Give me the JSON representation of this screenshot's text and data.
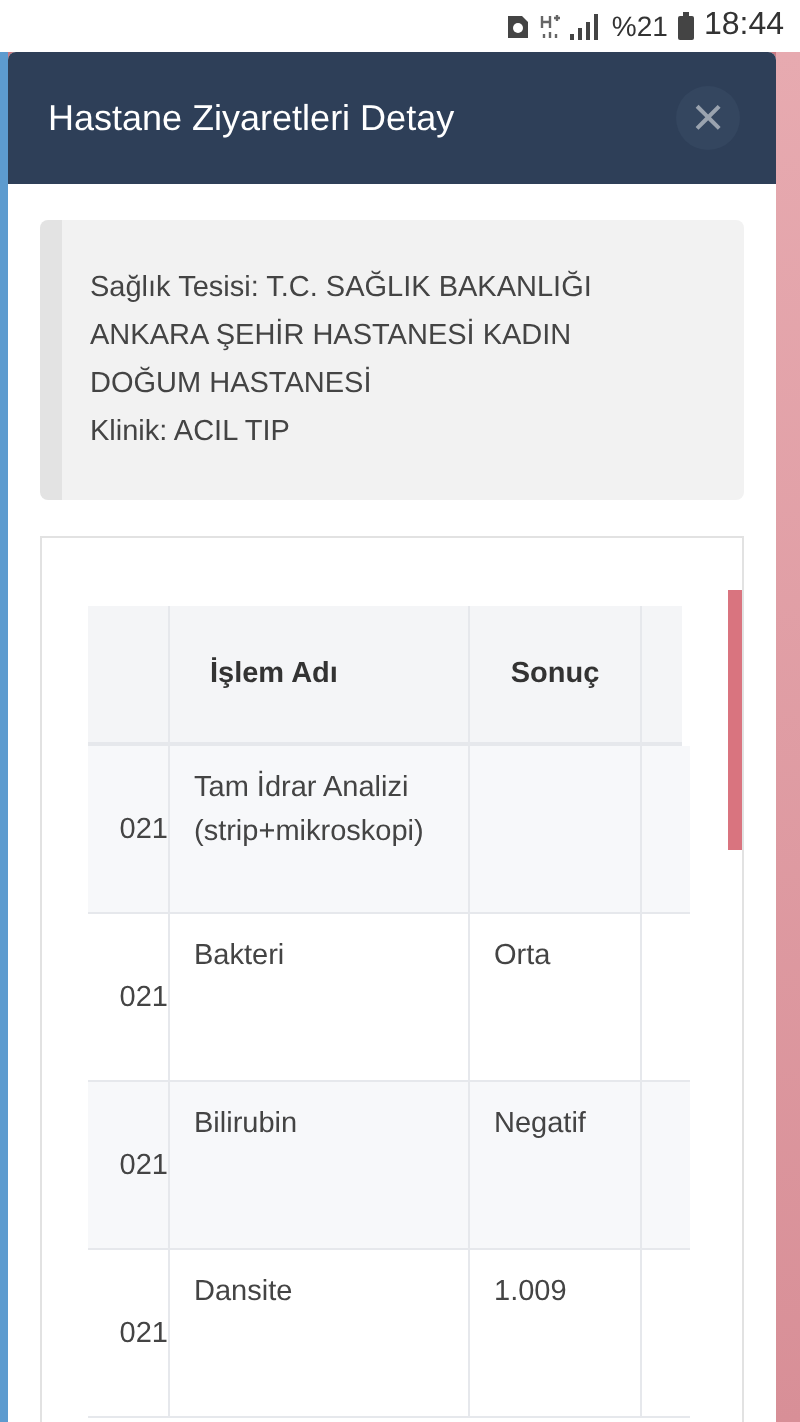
{
  "status_bar": {
    "battery_text": "%21",
    "time": "18:44"
  },
  "dialog": {
    "title": "Hastane Ziyaretleri Detay",
    "close_icon": "×"
  },
  "info": {
    "lines": [
      "Sağlık Tesisi: T.C. SAĞLIK BAKANLIĞI ANKARA ŞEHİR HASTANESİ KADIN DOĞUM HASTANESİ",
      "Klinik: ACIL TIP"
    ]
  },
  "table": {
    "columns": [
      "İşlem Adı",
      "Sonuç"
    ],
    "rows": [
      {
        "column_1": "021",
        "islem": "Tam İdrar Analizi (strip+mikroskopi)"
      },
      {
        "column_1": "021",
        "islem": "Bakteri",
        "sonuc": "Orta"
      },
      {
        "column_1": "021",
        "islem": "Bilirubin",
        "sonuc": "Negatif"
      },
      {
        "column_1": "021",
        "islem": "Dansite",
        "sonuc": "1.009"
      }
    ]
  }
}
